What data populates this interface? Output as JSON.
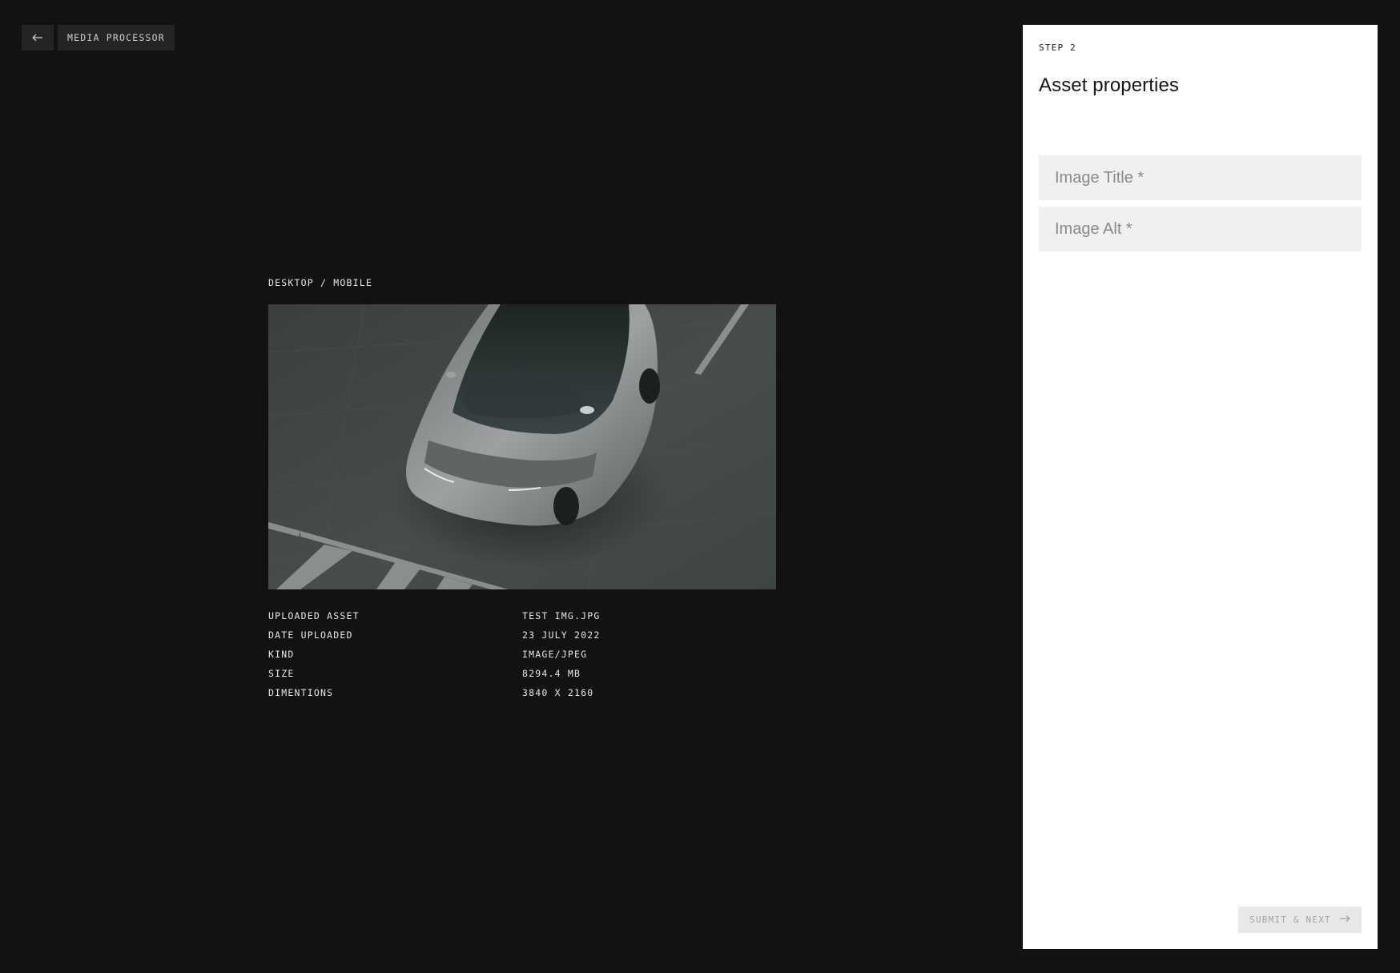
{
  "nav": {
    "back_icon": "arrow-left-icon",
    "breadcrumb": "MEDIA PROCESSOR"
  },
  "preview": {
    "label": "DESKTOP / MOBILE",
    "image_subject": "car-photo"
  },
  "asset_meta": [
    {
      "key": "UPLOADED ASSET",
      "value": "TEST IMG.JPG"
    },
    {
      "key": "DATE UPLOADED",
      "value": "23 JULY 2022"
    },
    {
      "key": "KIND",
      "value": "IMAGE/JPEG"
    },
    {
      "key": "SIZE",
      "value": "8294.4 MB"
    },
    {
      "key": "DIMENTIONS",
      "value": "3840 X 2160"
    }
  ],
  "panel": {
    "step": "STEP 2",
    "title": "Asset properties",
    "fields": {
      "image_title": {
        "placeholder": "Image Title *",
        "value": ""
      },
      "image_alt": {
        "placeholder": "Image Alt *",
        "value": ""
      }
    },
    "submit_label": "SUBMIT & NEXT",
    "submit_icon": "arrow-right-icon"
  },
  "colors": {
    "background": "#121212",
    "nav_button": "#242424",
    "panel": "#ffffff",
    "field_bg": "#f0f0f0",
    "button_disabled_bg": "#e8e8e8",
    "button_disabled_text": "#a3a3a3"
  }
}
